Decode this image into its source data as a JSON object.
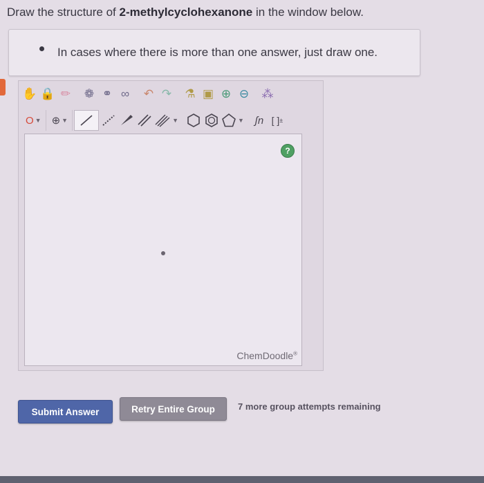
{
  "question": {
    "prefix": "Draw the structure of ",
    "compound": "2-methylcyclohexanone",
    "suffix": " in the window below."
  },
  "hint": {
    "text": "In cases where there is more than one answer, just draw one."
  },
  "editor": {
    "toolbar_row1": [
      {
        "icon": "hand-icon",
        "glyph": "✋"
      },
      {
        "icon": "lasso-lock-icon",
        "glyph": "🔒"
      },
      {
        "icon": "eraser-icon",
        "glyph": "✏"
      },
      {
        "icon": "ring-template-icon",
        "glyph": "❁"
      },
      {
        "icon": "copy-molecule-icon",
        "glyph": "⚭"
      },
      {
        "icon": "chain-icon",
        "glyph": "∞"
      },
      {
        "icon": "undo-icon",
        "glyph": "↶"
      },
      {
        "icon": "redo-icon",
        "glyph": "↷"
      },
      {
        "icon": "clean-icon",
        "glyph": "⚗"
      },
      {
        "icon": "open-document-icon",
        "glyph": "▣"
      },
      {
        "icon": "zoom-in-icon",
        "glyph": "⊕"
      },
      {
        "icon": "zoom-out-icon",
        "glyph": "⊖"
      },
      {
        "icon": "templates-icon",
        "glyph": "⁂"
      }
    ],
    "toolbar_row2": {
      "element_label": "O",
      "charge_symbol": "⊕",
      "ring_label_superscript": "±",
      "chain_label": "ʃn",
      "bracket_label": "[ ]"
    },
    "help_symbol": "?",
    "brand": "ChemDoodle",
    "brand_mark": "®"
  },
  "actions": {
    "submit_label": "Submit Answer",
    "retry_label": "Retry Entire Group",
    "attempts_text": "7 more group attempts remaining"
  },
  "colors": {
    "background": "#e4dde6",
    "submit": "#4f66a8",
    "retry": "#8f8a96",
    "help": "#4fa063",
    "accent_tab": "#e2683a"
  }
}
